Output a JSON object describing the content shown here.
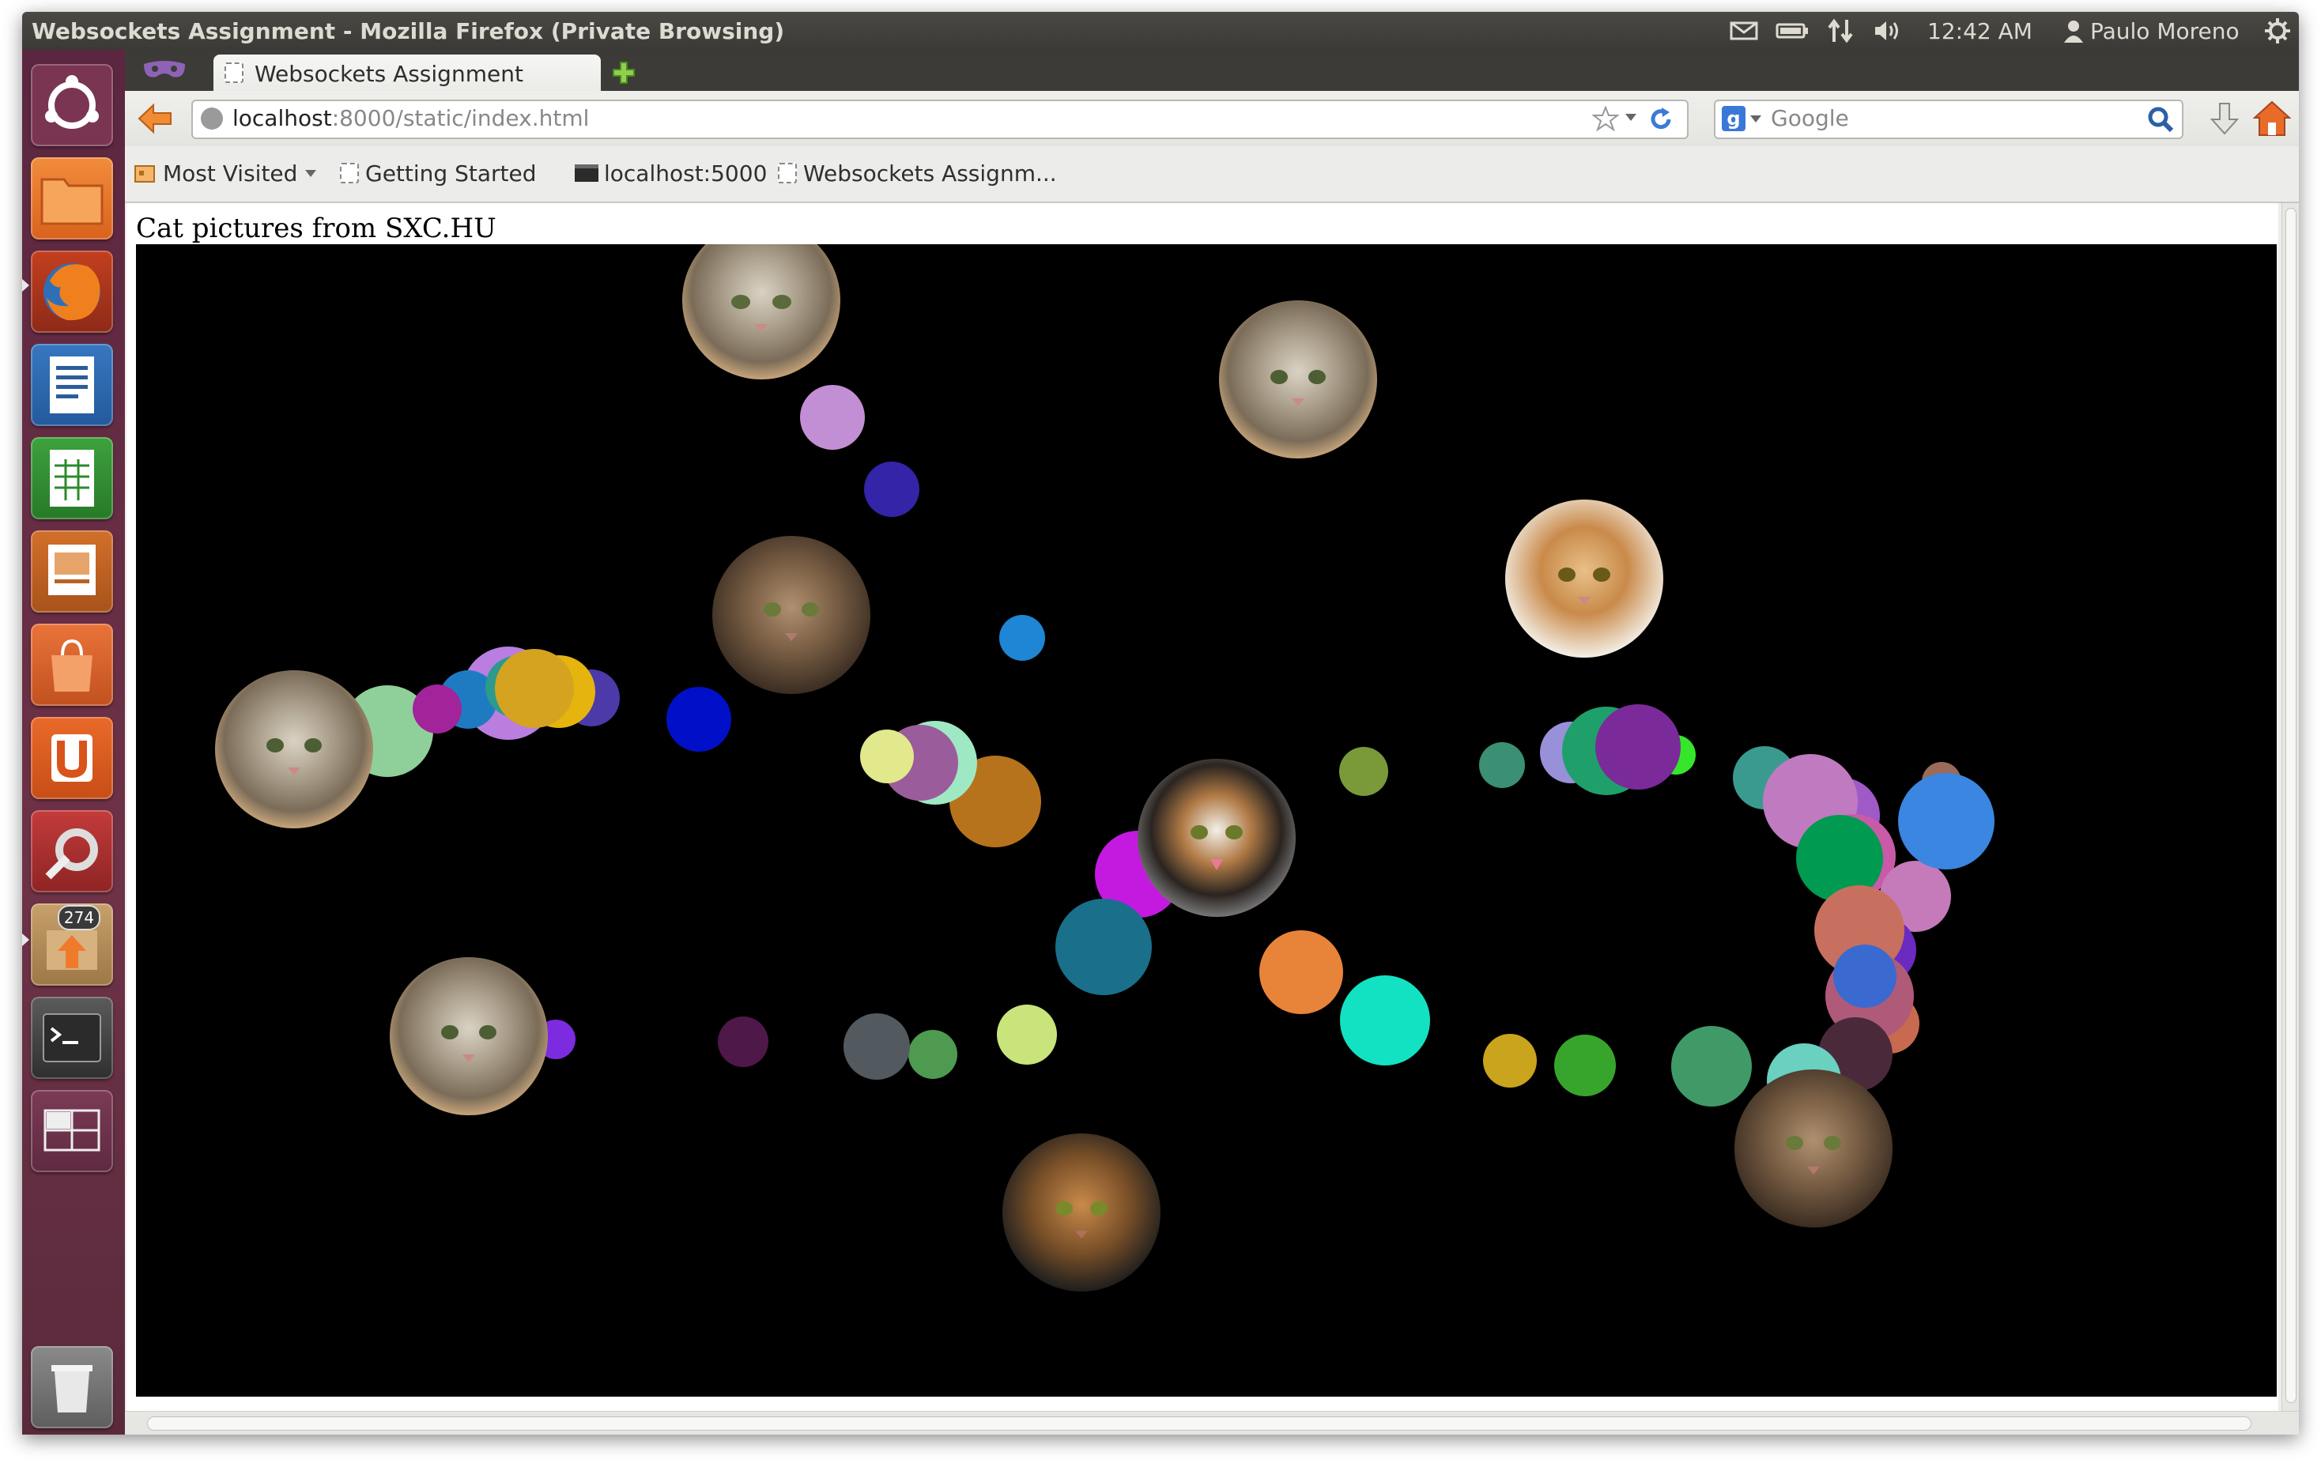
{
  "window": {
    "title": "Websockets Assignment - Mozilla Firefox (Private Browsing)"
  },
  "tray": {
    "time": "12:42 AM",
    "user": "Paulo Moreno"
  },
  "launcher": {
    "items": [
      {
        "name": "ubuntu-dash",
        "icon": "ubuntu-logo-icon"
      },
      {
        "name": "files",
        "icon": "folder-icon"
      },
      {
        "name": "firefox",
        "icon": "firefox-icon"
      },
      {
        "name": "writer",
        "icon": "document-icon"
      },
      {
        "name": "calc",
        "icon": "spreadsheet-icon"
      },
      {
        "name": "impress",
        "icon": "presentation-icon"
      },
      {
        "name": "software-center",
        "icon": "shopping-bag-icon"
      },
      {
        "name": "ubuntu-one",
        "icon": "ubuntu-one-icon"
      },
      {
        "name": "system-settings",
        "icon": "settings-icon"
      },
      {
        "name": "update-manager",
        "icon": "update-icon",
        "badge": "274"
      },
      {
        "name": "terminal",
        "icon": "terminal-icon"
      },
      {
        "name": "workspace-switcher",
        "icon": "workspace-icon"
      },
      {
        "name": "trash",
        "icon": "trash-icon"
      }
    ]
  },
  "browser": {
    "tab_label": "Websockets Assignment",
    "url_host": "localhost",
    "url_rest": ":8000/static/index.html",
    "search_placeholder": "Google",
    "bookmarks": [
      {
        "label": "Most Visited",
        "icon": "most-visited-icon",
        "dropdown": true
      },
      {
        "label": "Getting Started",
        "icon": "page-icon"
      },
      {
        "label": "localhost:5000",
        "icon": "terminal-page-icon"
      },
      {
        "label": "Websockets Assignm...",
        "icon": "page-icon"
      }
    ]
  },
  "page": {
    "caption": "Cat pictures from SXC.HU"
  },
  "colors": {
    "launcher_bg": "#5e2a42",
    "topbar_bg": "#3c3b37",
    "canvas_bg": "#000000"
  }
}
